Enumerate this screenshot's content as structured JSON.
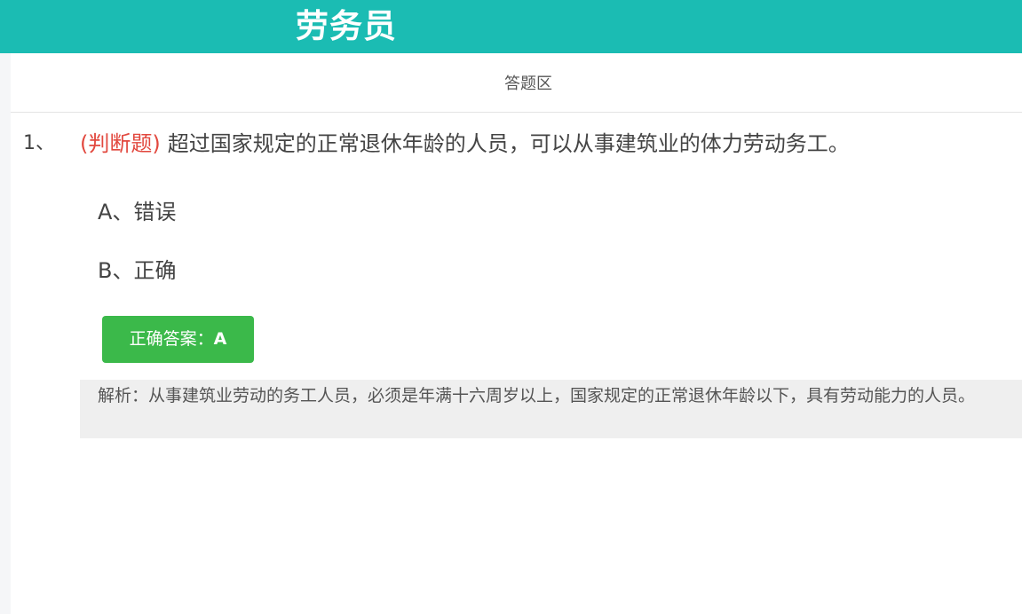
{
  "header": {
    "title": "劳务员"
  },
  "panel": {
    "title": "答题区"
  },
  "question": {
    "number": "1、",
    "type": "(判断题)",
    "text": "超过国家规定的正常退休年龄的人员，可以从事建筑业的体力劳动务工。",
    "options": [
      {
        "label": "A、错误"
      },
      {
        "label": "B、正确"
      }
    ],
    "answer_prefix": "正确答案：",
    "answer_value": "A",
    "analysis": "解析：从事建筑业劳动的务工人员，必须是年满十六周岁以上，国家规定的正常退休年龄以下，具有劳动能力的人员。"
  },
  "colors": {
    "header_bg": "#1bbcb3",
    "question_type": "#e2483e",
    "answer_button": "#3bb94a",
    "analysis_bg": "#efefef"
  }
}
